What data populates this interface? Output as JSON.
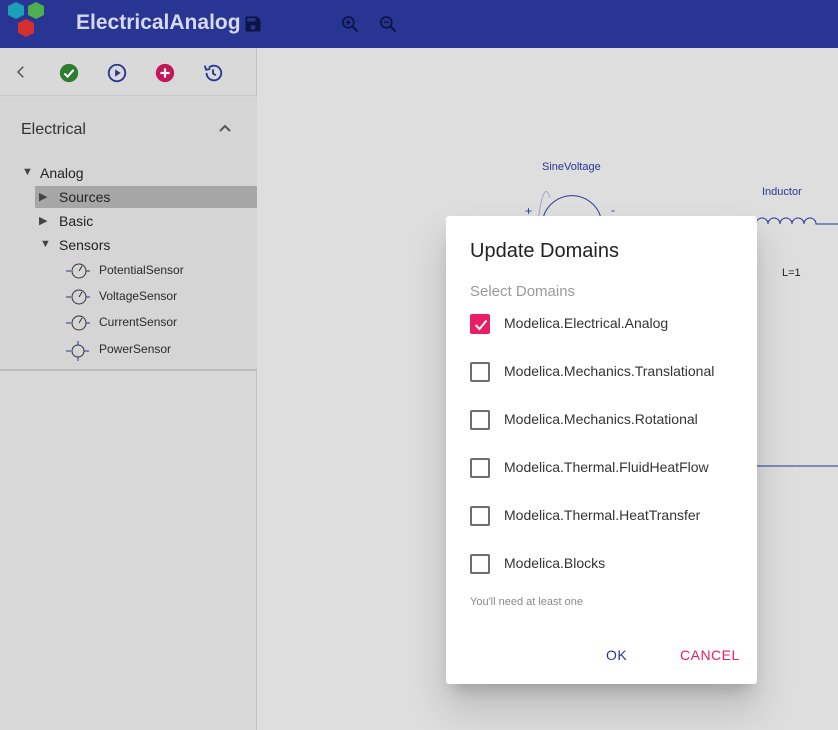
{
  "appbar": {
    "title": "ElectricalAnalog",
    "colors": {
      "bar": "#283593",
      "logo_blue": "#1e88e5",
      "logo_green": "#43a047",
      "logo_red": "#c62828"
    },
    "icons": [
      "save-icon",
      "zoom-in-icon",
      "zoom-out-icon"
    ]
  },
  "toolbar": {
    "icons": [
      "back-icon",
      "check-circle-icon",
      "play-circle-icon",
      "add-circle-icon",
      "history-icon"
    ]
  },
  "library": {
    "section_title": "Electrical",
    "tree": {
      "root": "Analog",
      "children": [
        "Sources",
        "Basic",
        "Sensors"
      ],
      "sensors": [
        "PotentialSensor",
        "VoltageSensor",
        "CurrentSensor",
        "PowerSensor"
      ]
    }
  },
  "canvas": {
    "labels": {
      "sine_voltage": "SineVoltage",
      "inductor": "Inductor",
      "inductance": "L=1",
      "plus": "+",
      "minus": "-"
    }
  },
  "dialog": {
    "title": "Update Domains",
    "subtitle": "Select Domains",
    "options": [
      {
        "label": "Modelica.Electrical.Analog",
        "checked": true
      },
      {
        "label": "Modelica.Mechanics.Translational",
        "checked": false
      },
      {
        "label": "Modelica.Mechanics.Rotational",
        "checked": false
      },
      {
        "label": "Modelica.Thermal.FluidHeatFlow",
        "checked": false
      },
      {
        "label": "Modelica.Thermal.HeatTransfer",
        "checked": false
      },
      {
        "label": "Modelica.Blocks",
        "checked": false
      }
    ],
    "helper": "You'll need at least one",
    "ok_label": "OK",
    "cancel_label": "CANCEL",
    "colors": {
      "accent": "#e91e63",
      "primary": "#283593"
    }
  }
}
